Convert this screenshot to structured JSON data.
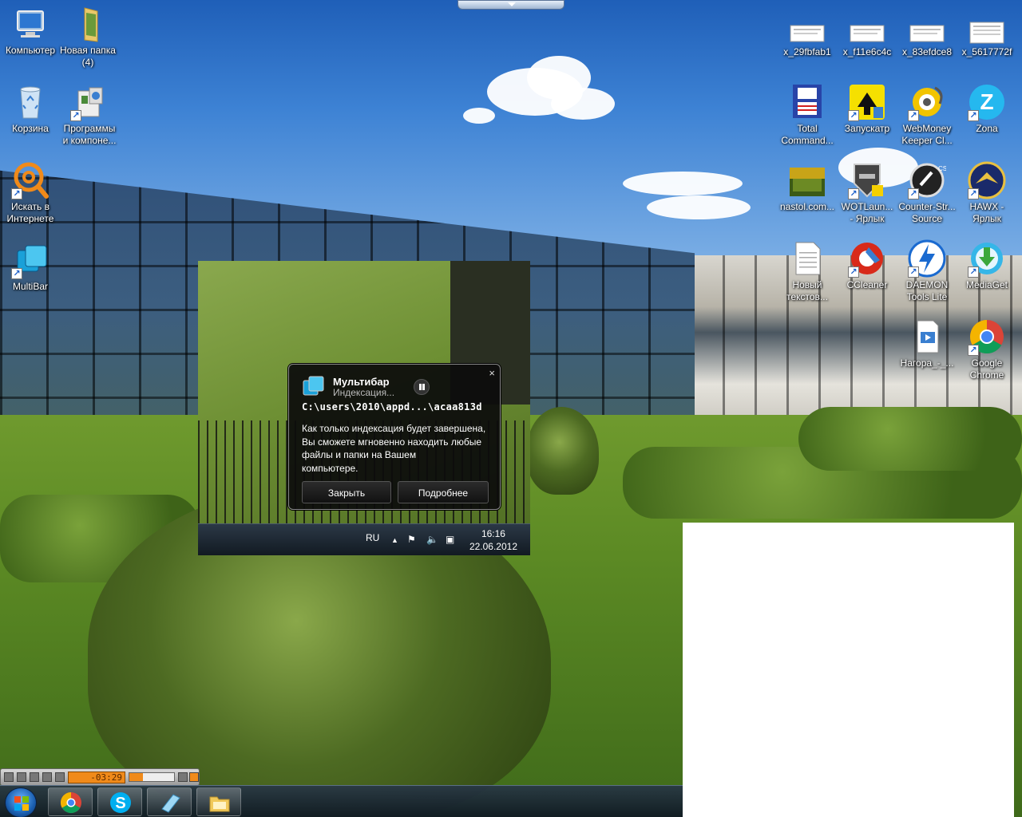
{
  "desktop": {
    "left_icons": [
      {
        "name": "computer",
        "label": "Компьютер"
      },
      {
        "name": "new-folder",
        "label": "Новая папка\n(4)"
      },
      {
        "name": "recycle-bin",
        "label": "Корзина"
      },
      {
        "name": "programs",
        "label": "Программы\nи компоне..."
      },
      {
        "name": "search-internet",
        "label": "Искать в\nИнтернете"
      },
      {
        "name": "multibar",
        "label": "MultiBar"
      }
    ],
    "right_icons": [
      {
        "name": "file-29fbfab1",
        "label": "x_29fbfab1"
      },
      {
        "name": "file-f11e6c4c",
        "label": "x_f11e6c4c"
      },
      {
        "name": "file-83efdce8",
        "label": "x_83efdce8"
      },
      {
        "name": "file-5617772f",
        "label": "x_5617772f"
      },
      {
        "name": "total-commander",
        "label": "Total\nCommand..."
      },
      {
        "name": "zapuskatr",
        "label": "Запускатр"
      },
      {
        "name": "webmoney",
        "label": "WebMoney\nKeeper Cl..."
      },
      {
        "name": "zona",
        "label": "Zona"
      },
      {
        "name": "nastol",
        "label": "nastol.com..."
      },
      {
        "name": "wotlauncher",
        "label": "WOTLaun...\n- Ярлык"
      },
      {
        "name": "counter-strike",
        "label": "Counter-Str...\nSource"
      },
      {
        "name": "hawx",
        "label": "HAWX -\nЯрлык"
      },
      {
        "name": "new-text",
        "label": "Новый\nтекстов..."
      },
      {
        "name": "ccleaner",
        "label": "CCleaner"
      },
      {
        "name": "daemon-tools",
        "label": "DAEMON\nTools Lite"
      },
      {
        "name": "mediaget",
        "label": "MediaGet"
      },
      {
        "name": "nagora",
        "label": "Нагора_-_..."
      },
      {
        "name": "google-chrome",
        "label": "Google\nChrome"
      }
    ]
  },
  "popup": {
    "title": "Мультибар",
    "subtitle": "Индексация...",
    "path": "C:\\users\\2010\\appd...\\acaa813d",
    "body": "Как только индексация будет завершена, Вы сможете мгновенно находить любые файлы и папки на Вашем        компьютере.",
    "close_label": "Закрыть",
    "more_label": "Подробнее",
    "close_glyph": "×"
  },
  "tray": {
    "language": "RU",
    "time": "16:16",
    "date": "22.06.2012"
  },
  "player": {
    "time": "-03:29"
  },
  "taskbar": {
    "items": [
      "chrome",
      "skype",
      "multibar",
      "explorer"
    ]
  }
}
